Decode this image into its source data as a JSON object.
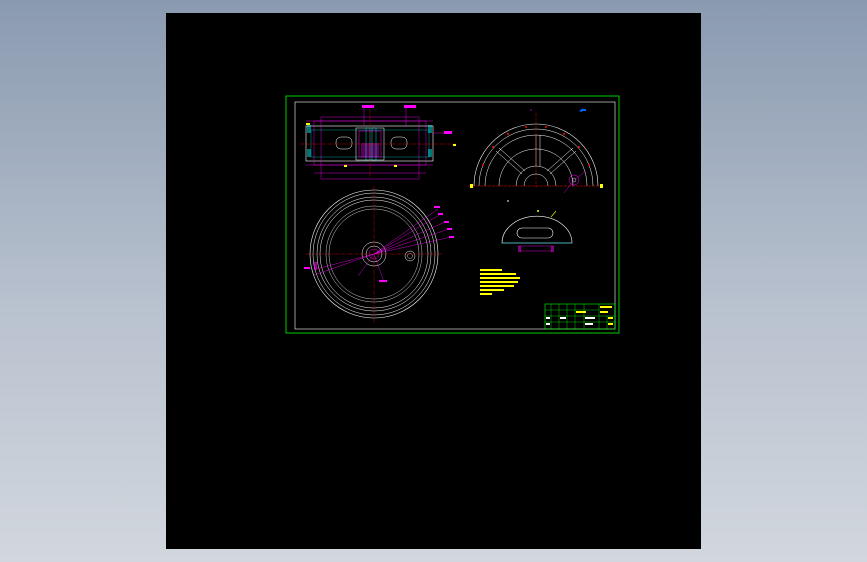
{
  "app": {
    "viewport_background": "#000000",
    "page_background": "#a5b1c1"
  },
  "drawing": {
    "colors": {
      "frame": "#00ff00",
      "geometry": "#ffffff",
      "dimension": "#ff00ff",
      "center_line": "#ff0000",
      "notes": "#ffff00",
      "title_block": "#00ff00",
      "hatch": "#00ffff"
    },
    "labels": {
      "section_marker_a": "A",
      "section_marker_b": "B",
      "view_label": "A"
    },
    "technical_notes": [
      "",
      "",
      "",
      ""
    ]
  }
}
